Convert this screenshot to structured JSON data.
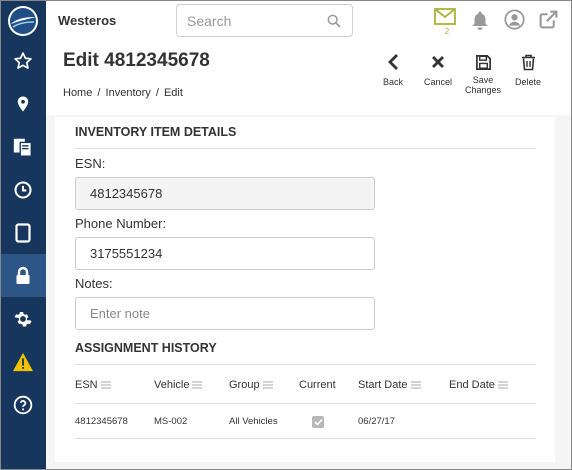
{
  "app": {
    "name": "Westeros"
  },
  "search": {
    "placeholder": "Search"
  },
  "notifications": {
    "mail_count": "2"
  },
  "page": {
    "title": "Edit 4812345678",
    "breadcrumb": [
      "Home",
      "Inventory",
      "Edit"
    ],
    "breadcrumb_separator": "/"
  },
  "actions": {
    "back": "Back",
    "cancel": "Cancel",
    "save_line1": "Save",
    "save_line2": "Changes",
    "delete": "Delete"
  },
  "details": {
    "title": "INVENTORY ITEM DETAILS",
    "esn_label": "ESN:",
    "esn_value": "4812345678",
    "phone_label": "Phone Number:",
    "phone_value": "3175551234",
    "notes_label": "Notes:",
    "notes_placeholder": "Enter note"
  },
  "history": {
    "title": "ASSIGNMENT HISTORY",
    "columns": [
      "ESN",
      "Vehicle",
      "Group",
      "Current",
      "Start Date",
      "End Date"
    ],
    "rows": [
      {
        "esn": "4812345678",
        "vehicle": "MS-002",
        "group": "All Vehicles",
        "current": true,
        "start_date": "06/27/17",
        "end_date": ""
      }
    ]
  },
  "sidebar": {
    "items": [
      {
        "icon": "star-icon"
      },
      {
        "icon": "map-pin-icon"
      },
      {
        "icon": "documents-icon"
      },
      {
        "icon": "clock-icon"
      },
      {
        "icon": "tablet-icon"
      },
      {
        "icon": "lock-icon",
        "active": true
      },
      {
        "icon": "gear-icon"
      },
      {
        "icon": "warning-icon"
      },
      {
        "icon": "help-icon"
      }
    ]
  },
  "colors": {
    "sidebar": "#17365d",
    "sidebar_active": "#2c5686",
    "warning": "#f2c200",
    "mail": "#a7b43a"
  }
}
